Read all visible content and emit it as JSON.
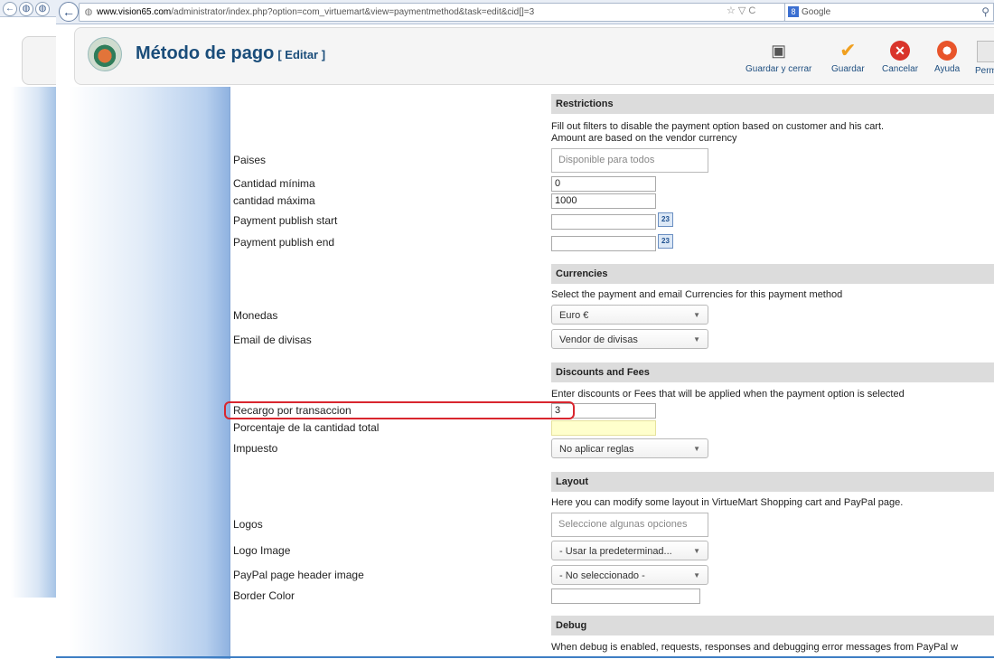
{
  "browser": {
    "url_domain": "www.vision65.com",
    "url_path": "/administrator/index.php?option=com_virtuemart&view=paymentmethod&task=edit&cid[]=3",
    "nav_icons": "☆ ▽ C",
    "search_engine": "Google"
  },
  "header": {
    "title": "Método de pago",
    "subtitle": "[ Editar ]",
    "toolbar": {
      "save_close": "Guardar y cerrar",
      "save": "Guardar",
      "cancel": "Cancelar",
      "help": "Ayuda",
      "perms": "Perm"
    }
  },
  "sections": {
    "restrictions": {
      "title": "Restrictions",
      "desc_line1": "Fill out filters to disable the payment option based on customer and his cart.",
      "desc_line2": "Amount are based on the vendor currency"
    },
    "currencies": {
      "title": "Currencies",
      "desc": "Select the payment and email Currencies for this payment method"
    },
    "discounts": {
      "title": "Discounts and Fees",
      "desc": "Enter discounts or Fees that will be applied when the payment option is selected"
    },
    "layout": {
      "title": "Layout",
      "desc": "Here you can modify some layout in VirtueMart Shopping cart and PayPal page."
    },
    "debug": {
      "title": "Debug",
      "desc": "When debug is enabled, requests, responses and debugging error messages from PayPal w"
    }
  },
  "fields": {
    "paises": {
      "label": "Paises",
      "placeholder": "Disponible para todos"
    },
    "min": {
      "label": "Cantidad mínima",
      "value": "0"
    },
    "max": {
      "label": "cantidad máxima",
      "value": "1000"
    },
    "publish_start": {
      "label": "Payment publish start",
      "value": "",
      "cal": "23"
    },
    "publish_end": {
      "label": "Payment publish end",
      "value": "",
      "cal": "23"
    },
    "monedas": {
      "label": "Monedas",
      "value": "Euro €"
    },
    "email_currency": {
      "label": "Email de divisas",
      "value": "Vendor de divisas"
    },
    "recargo": {
      "label": "Recargo por transaccion",
      "value": "3"
    },
    "porcentaje": {
      "label": "Porcentaje de la cantidad total",
      "value": ""
    },
    "impuesto": {
      "label": "Impuesto",
      "value": "No aplicar reglas"
    },
    "logos": {
      "label": "Logos",
      "placeholder": "Seleccione algunas opciones"
    },
    "logo_image": {
      "label": "Logo Image",
      "value": "- Usar la predeterminad..."
    },
    "header_image": {
      "label": "PayPal page header image",
      "value": "- No seleccionado -"
    },
    "border_color": {
      "label": "Border Color",
      "value": ""
    }
  },
  "colors": {
    "accent": "#1a4d7a",
    "highlight": "#d9262e",
    "section_bg": "#dcdcdc",
    "required_bg": "#ffffcc"
  }
}
